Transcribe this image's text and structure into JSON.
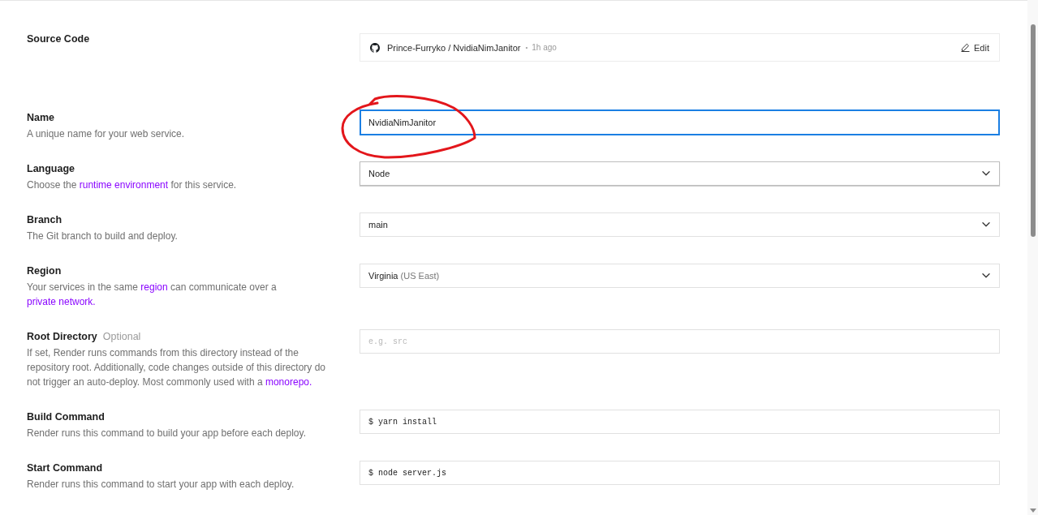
{
  "source_code": {
    "label": "Source Code",
    "repository": "Prince-Furryko / NvidiaNimJanitor",
    "separator": "•",
    "updated": "1h ago",
    "edit_button": "Edit"
  },
  "fields": [
    {
      "kind": "text",
      "label": "Name",
      "description": [
        {
          "kind": "text",
          "text": "A unique name for your web service."
        }
      ],
      "value": "NvidiaNimJanitor",
      "focused": true,
      "hovered": false,
      "circled": true
    },
    {
      "kind": "select",
      "label": "Language",
      "description": [
        {
          "kind": "text",
          "text": "Choose the "
        },
        {
          "kind": "link",
          "text": "runtime environment"
        },
        {
          "kind": "text",
          "text": " for this service."
        }
      ],
      "value": "Node",
      "focused": false,
      "hovered": true,
      "circled": false
    },
    {
      "kind": "select",
      "label": "Branch",
      "description": [
        {
          "kind": "text",
          "text": "The Git branch to build and deploy."
        }
      ],
      "value": "main",
      "focused": false,
      "hovered": false,
      "circled": false
    },
    {
      "kind": "select",
      "label": "Region",
      "description": [
        {
          "kind": "text",
          "text": "Your services in the same "
        },
        {
          "kind": "link",
          "text": "region"
        },
        {
          "kind": "text",
          "text": " can communicate over a "
        },
        {
          "kind": "link",
          "text": "private network."
        }
      ],
      "value": "Virginia",
      "detail": "(US East)",
      "focused": false,
      "hovered": false,
      "circled": false
    },
    {
      "kind": "path",
      "label": "Root Directory",
      "tag": "Optional",
      "description": [
        {
          "kind": "text",
          "text": "If set, Render runs commands from this directory instead of the repository root. Additionally, code changes outside of this directory do not trigger an auto-deploy. Most commonly used with a "
        },
        {
          "kind": "link",
          "text": "monorepo."
        }
      ],
      "placeholder": "e.g. src",
      "focused": false,
      "hovered": false,
      "circled": false
    },
    {
      "kind": "command",
      "label": "Build Command",
      "description": [
        {
          "kind": "text",
          "text": "Render runs this command to build your app before each deploy."
        }
      ],
      "prefix": "$",
      "value": "yarn install",
      "focused": false,
      "hovered": false,
      "circled": false
    },
    {
      "kind": "command",
      "label": "Start Command",
      "description": [
        {
          "kind": "text",
          "text": "Render runs this command to start your app with each deploy."
        }
      ],
      "prefix": "$",
      "value": "node server.js",
      "focused": false,
      "hovered": false,
      "circled": false
    }
  ]
}
